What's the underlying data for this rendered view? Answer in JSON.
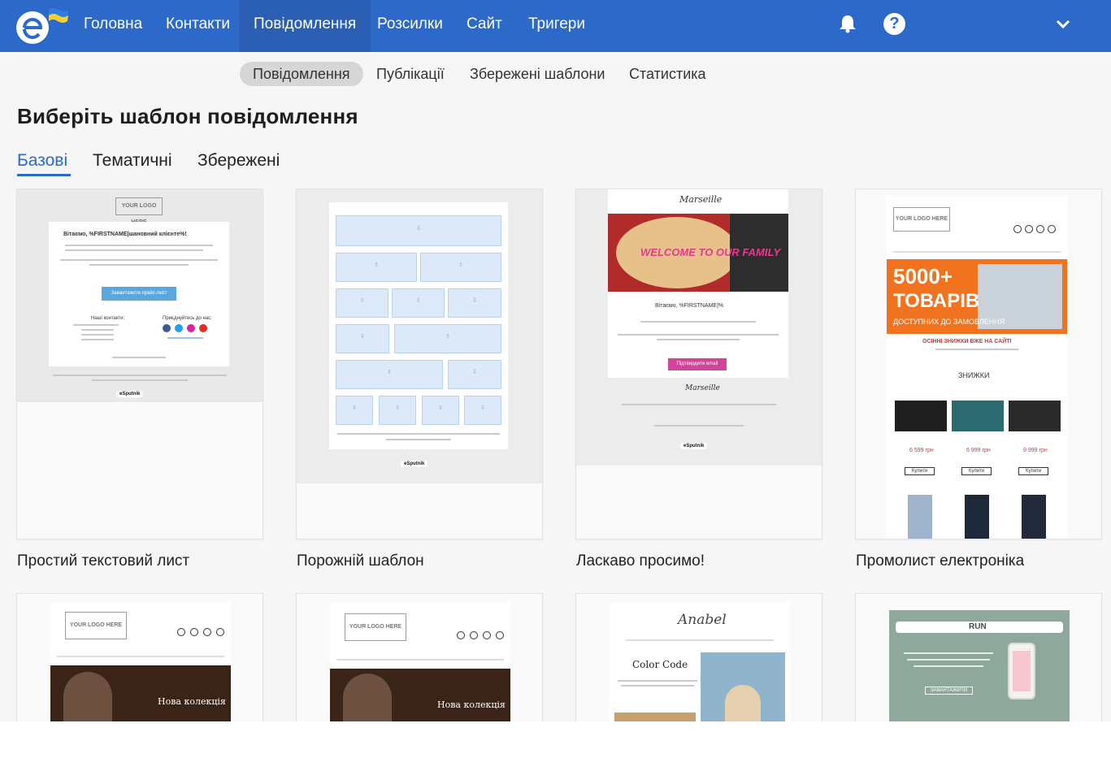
{
  "nav": {
    "items": [
      "Головна",
      "Контакти",
      "Повідомлення",
      "Розсилки",
      "Сайт",
      "Тригери"
    ],
    "active_index": 2
  },
  "subnav": {
    "items": [
      "Повідомлення",
      "Публікації",
      "Збережені шаблони",
      "Статистика"
    ],
    "active_index": 0
  },
  "page_title": "Виберіть шаблон повідомлення",
  "tabs": {
    "items": [
      "Базові",
      "Тематичні",
      "Збережені"
    ],
    "active_index": 0
  },
  "colors": {
    "nav_bg": "#2c69c8",
    "accent": "#2c69c8"
  },
  "icons": {
    "bell": "bell-icon",
    "help": "help-icon",
    "chevron": "chevron-down-icon"
  },
  "help_glyph": "?",
  "templates": [
    {
      "title": "Простий текстовий лист",
      "logo": "YOUR LOGO HERE",
      "greeting": "Вітаємо, %FIRSTNAME|шановний клієнте%!",
      "button": "Завантажити прайс-лист",
      "contacts_label": "Наші контакти:",
      "social_label": "Приєднуйтесь до нас:",
      "footer_badge": "eSputnik"
    },
    {
      "title": "Порожній шаблон",
      "footer_badge": "eSputnik"
    },
    {
      "title": "Ласкаво просимо!",
      "brand": "Marseille",
      "banner_text": "WELCOME TO OUR FAMILY",
      "greeting": "Вітаємо, %FIRSTNAME|%",
      "button": "Підтвердити email",
      "footer_brand": "Marseille",
      "footer_badge": "eSputnik"
    },
    {
      "title": "Промолист електроніка",
      "logo": "YOUR LOGO HERE",
      "banner_big": "5000+",
      "banner_word": "ТОВАРІВ",
      "banner_sub": "ДОСТУПНИХ ДО ЗАМОВЛЕННЯ",
      "promo_line": "ОСІННІ ЗНИЖКИ ВЖЕ НА САЙТІ",
      "section": "ЗНИЖКИ",
      "prices": [
        "6 599 грн",
        "6 999 грн",
        "9 999 грн"
      ],
      "buy": "Купити"
    },
    {
      "logo": "YOUR LOGO HERE",
      "caption": "Нова колекція"
    },
    {
      "logo": "YOUR LOGO HERE",
      "caption": "Нова колекція"
    },
    {
      "brand": "Anabel",
      "headline": "Color Code"
    },
    {
      "header": "RUN",
      "button": "ЗАВАНТАЖИТИ"
    }
  ]
}
